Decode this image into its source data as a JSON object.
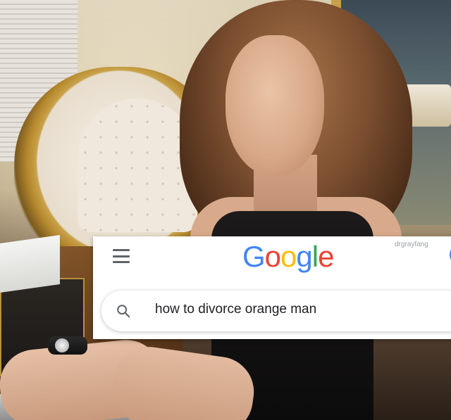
{
  "header": {
    "logo_letters": [
      {
        "char": "G",
        "color": "#4285F4"
      },
      {
        "char": "o",
        "color": "#EA4335"
      },
      {
        "char": "o",
        "color": "#FBBC05"
      },
      {
        "char": "g",
        "color": "#4285F4"
      },
      {
        "char": "l",
        "color": "#34A853"
      },
      {
        "char": "e",
        "color": "#EA4335"
      }
    ],
    "watermark": "drgrayfang",
    "menu_icon": "hamburger-menu-icon"
  },
  "search": {
    "icon": "search-icon",
    "query": "how to divorce orange man"
  },
  "colors": {
    "icon_gray": "#5f6368",
    "text": "#202124",
    "avatar_ring": "#4285F4"
  }
}
